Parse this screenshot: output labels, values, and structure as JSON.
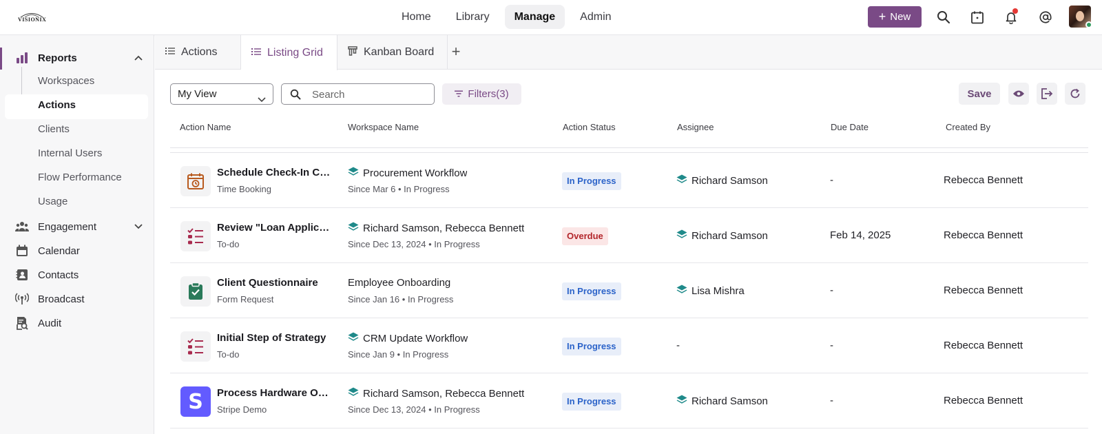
{
  "brand": {
    "name": "VISIONIX"
  },
  "topnav": [
    {
      "label": "Home"
    },
    {
      "label": "Library"
    },
    {
      "label": "Manage"
    },
    {
      "label": "Admin"
    }
  ],
  "header": {
    "new_label": "New"
  },
  "sidebar": {
    "reports": "Reports",
    "sub": [
      "Workspaces",
      "Actions",
      "Clients",
      "Internal Users",
      "Flow Performance",
      "Usage"
    ],
    "engagement": "Engagement",
    "calendar": "Calendar",
    "contacts": "Contacts",
    "broadcast": "Broadcast",
    "audit": "Audit"
  },
  "tabs": [
    {
      "label": "Actions"
    },
    {
      "label": "Listing Grid"
    },
    {
      "label": "Kanban Board"
    }
  ],
  "toolbar": {
    "view": "My View",
    "search_placeholder": "Search",
    "filters": "Filters(3)",
    "save": "Save"
  },
  "columns": [
    "Action Name",
    "Workspace Name",
    "Action Status",
    "Assignee",
    "Due Date",
    "Created By"
  ],
  "rows": [
    {
      "title": "Schedule Check-In Call",
      "type": "Time Booking",
      "workspace": "Procurement Workflow",
      "since": "Since Mar 6",
      "ws_status": "In Progress",
      "status": "In Progress",
      "assignee": "Richard Samson",
      "due": "-",
      "creator": "Rebecca Bennett"
    },
    {
      "title": "Review \"Loan Application\"",
      "type": "To-do",
      "workspace": "Richard Samson, Rebecca Bennett",
      "since": "Since Dec 13, 2024",
      "ws_status": "In Progress",
      "status": "Overdue",
      "assignee": "Richard Samson",
      "due": "Feb 14, 2025",
      "creator": "Rebecca Bennett"
    },
    {
      "title": "Client Questionnaire",
      "type": "Form Request",
      "workspace": "Employee Onboarding",
      "since": "Since Jan 16",
      "ws_status": "In Progress",
      "status": "In Progress",
      "assignee": "Lisa Mishra",
      "due": "-",
      "creator": "Rebecca Bennett"
    },
    {
      "title": "Initial Step of Strategy",
      "type": "To-do",
      "workspace": "CRM Update Workflow",
      "since": "Since Jan 9",
      "ws_status": "In Progress",
      "status": "In Progress",
      "assignee": "-",
      "due": "-",
      "creator": "Rebecca Bennett"
    },
    {
      "title": "Process Hardware Order",
      "type": "Stripe Demo",
      "workspace": "Richard Samson, Rebecca Bennett",
      "since": "Since Dec 13, 2024",
      "ws_status": "In Progress",
      "status": "In Progress",
      "assignee": "Richard Samson",
      "due": "-",
      "creator": "Rebecca Bennett"
    }
  ],
  "stripe_letter": "S",
  "colors": {
    "accent": "#7a4a86",
    "progress": "#2b63c9",
    "overdue": "#b3262b",
    "teal": "#1f8a8a"
  }
}
